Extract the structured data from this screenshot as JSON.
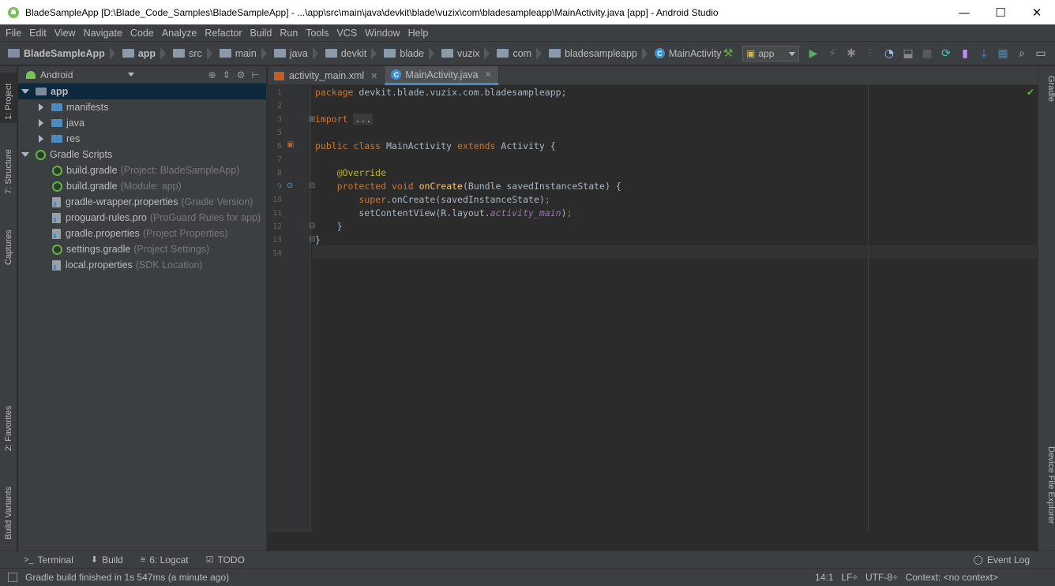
{
  "window": {
    "title": "BladeSampleApp [D:\\Blade_Code_Samples\\BladeSampleApp] - ...\\app\\src\\main\\java\\devkit\\blade\\vuzix\\com\\bladesampleapp\\MainActivity.java [app] - Android Studio",
    "minimize": "—",
    "maximize": "☐",
    "close": "✕"
  },
  "menu": [
    "File",
    "Edit",
    "View",
    "Navigate",
    "Code",
    "Analyze",
    "Refactor",
    "Build",
    "Run",
    "Tools",
    "VCS",
    "Window",
    "Help"
  ],
  "breadcrumbs": [
    "BladeSampleApp",
    "app",
    "src",
    "main",
    "java",
    "devkit",
    "blade",
    "vuzix",
    "com",
    "bladesampleapp",
    "MainActivity"
  ],
  "toolbar": {
    "run_config": "app"
  },
  "left_tabs": [
    "1: Project",
    "7: Structure",
    "Captures",
    "2: Favorites",
    "Build Variants"
  ],
  "right_tabs": [
    "Gradle",
    "Device File Explorer"
  ],
  "project": {
    "view_mode": "Android",
    "tree": [
      {
        "label": "app",
        "hint": "",
        "level": 0,
        "kind": "app",
        "expanded": true,
        "selected": true
      },
      {
        "label": "manifests",
        "hint": "",
        "level": 1,
        "kind": "folder",
        "expanded": false
      },
      {
        "label": "java",
        "hint": "",
        "level": 1,
        "kind": "folder",
        "expanded": false
      },
      {
        "label": "res",
        "hint": "",
        "level": 1,
        "kind": "folder",
        "expanded": false
      },
      {
        "label": "Gradle Scripts",
        "hint": "",
        "level": 0,
        "kind": "gradle",
        "expanded": true
      },
      {
        "label": "build.gradle",
        "hint": "(Project: BladeSampleApp)",
        "level": 1,
        "kind": "gradle"
      },
      {
        "label": "build.gradle",
        "hint": "(Module: app)",
        "level": 1,
        "kind": "gradle"
      },
      {
        "label": "gradle-wrapper.properties",
        "hint": "(Gradle Version)",
        "level": 1,
        "kind": "props"
      },
      {
        "label": "proguard-rules.pro",
        "hint": "(ProGuard Rules for app)",
        "level": 1,
        "kind": "props"
      },
      {
        "label": "gradle.properties",
        "hint": "(Project Properties)",
        "level": 1,
        "kind": "props"
      },
      {
        "label": "settings.gradle",
        "hint": "(Project Settings)",
        "level": 1,
        "kind": "gradle"
      },
      {
        "label": "local.properties",
        "hint": "(SDK Location)",
        "level": 1,
        "kind": "props"
      }
    ]
  },
  "editor": {
    "tabs": [
      {
        "label": "activity_main.xml",
        "active": false
      },
      {
        "label": "MainActivity.java",
        "active": true
      }
    ],
    "lines": [
      {
        "num": "1",
        "html": "<span class=\"kw\">package</span> devkit.blade.vuzix.com.bladesampleapp;"
      },
      {
        "num": "2",
        "html": ""
      },
      {
        "num": "3",
        "html": "<span class=\"kw\">import</span> <span class=\"fold-box\">...</span>"
      },
      {
        "num": "5",
        "html": ""
      },
      {
        "num": "6",
        "html": "<span class=\"kw\">public class</span> MainActivity <span class=\"kw\">extends</span> Activity {"
      },
      {
        "num": "7",
        "html": ""
      },
      {
        "num": "8",
        "html": "    <span class=\"ann\">@Override</span>"
      },
      {
        "num": "9",
        "html": "    <span class=\"kw\">protected void</span> <span class=\"fn\">onCreate</span>(Bundle savedInstanceState) {"
      },
      {
        "num": "10",
        "html": "        <span class=\"kw\">super</span>.onCreate(savedInstanceState)<span class=\"kw\">;</span>"
      },
      {
        "num": "11",
        "html": "        setContentView(R.layout.<span class=\"field\">activity_main</span>)<span class=\"kw\">;</span>"
      },
      {
        "num": "12",
        "html": "    }"
      },
      {
        "num": "13",
        "html": "}"
      },
      {
        "num": "14",
        "html": ""
      }
    ]
  },
  "bottom_tools": [
    {
      "icon": ">_",
      "label": "Terminal"
    },
    {
      "icon": "⬇",
      "label": "Build"
    },
    {
      "icon": "≡",
      "label": "6: Logcat"
    },
    {
      "icon": "☑",
      "label": "TODO"
    }
  ],
  "event_log": "Event Log",
  "status": {
    "message": "Gradle build finished in 1s 547ms (a minute ago)",
    "position": "14:1",
    "line_sep": "LF÷",
    "encoding": "UTF-8÷",
    "context": "Context: <no context>"
  }
}
